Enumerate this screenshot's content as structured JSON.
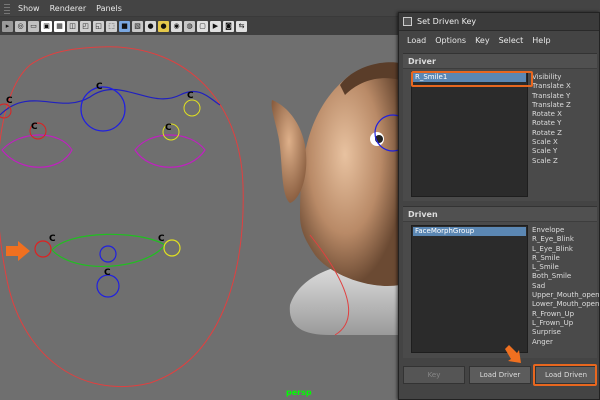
{
  "menubar": {
    "items": [
      "Show",
      "Renderer",
      "Panels"
    ]
  },
  "toolbar": {
    "buttons": [
      {
        "icon": "select-icon",
        "color": "#9a9a9a"
      },
      {
        "icon": "camera-icon",
        "color": "#c0c0c0"
      },
      {
        "icon": "bookmark-icon",
        "color": "#c0c0c0"
      },
      {
        "icon": "image-plane-icon",
        "color": "#ffffff"
      },
      {
        "icon": "grid-icon",
        "color": "#ffffff"
      },
      {
        "icon": "film-gate-icon",
        "color": "#d0d0d0"
      },
      {
        "icon": "resolution-gate-icon",
        "color": "#d0d0d0"
      },
      {
        "icon": "safe-action-icon",
        "color": "#d0d0d0"
      },
      {
        "icon": "wireframe-cube-icon",
        "color": "#cfcfcf"
      },
      {
        "icon": "smooth-shade-icon",
        "color": "#7aa7e0"
      },
      {
        "icon": "textured-icon",
        "color": "#c8c8c8"
      },
      {
        "icon": "use-lights-icon",
        "color": "#d8d8d8"
      },
      {
        "icon": "shadows-icon",
        "color": "#e5c84a"
      },
      {
        "icon": "high-quality-icon",
        "color": "#dcdcdc"
      },
      {
        "icon": "xray-icon",
        "color": "#c8c8c8"
      },
      {
        "icon": "isolate-icon",
        "color": "#e0e0e0"
      },
      {
        "icon": "playblast-icon",
        "color": "#e0e0e0"
      },
      {
        "icon": "snapshot-icon",
        "color": "#e0e0e0"
      },
      {
        "icon": "share-icon",
        "color": "#e0e0e0"
      }
    ]
  },
  "viewport": {
    "camera_label": "persp",
    "control_letter": "C"
  },
  "sdk": {
    "title": "Set Driven Key",
    "menu": [
      "Load",
      "Options",
      "Key",
      "Select",
      "Help"
    ],
    "driver": {
      "heading": "Driver",
      "objects": [
        "R_Smile1"
      ],
      "attributes": [
        "Visibility",
        "Translate X",
        "Translate Y",
        "Translate Z",
        "Rotate X",
        "Rotate Y",
        "Rotate Z",
        "Scale X",
        "Scale Y",
        "Scale Z"
      ]
    },
    "driven": {
      "heading": "Driven",
      "objects": [
        "FaceMorphGroup"
      ],
      "attributes": [
        "Envelope",
        "R_Eye_Blink",
        "L_Eye_Blink",
        "R_Smile",
        "L_Smile",
        "Both_Smile",
        "Sad",
        "Upper_Mouth_open",
        "Lower_Mouth_open",
        "R_Frown_Up",
        "L_Frown_Up",
        "Surprise",
        "Anger"
      ]
    },
    "buttons": {
      "key": "Key",
      "load_driver": "Load Driver",
      "load_driven": "Load Driven"
    }
  },
  "colors": {
    "highlight": "#e8671f",
    "selection": "#5b87b3"
  }
}
